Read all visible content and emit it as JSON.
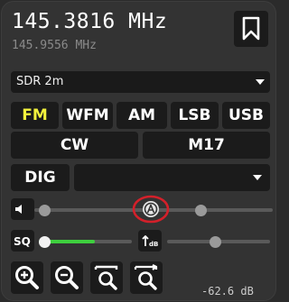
{
  "frequency": {
    "main": "145.3816 MHz",
    "secondary": "145.9556 MHz"
  },
  "profile_select": {
    "value": "SDR 2m"
  },
  "modes": {
    "row1": [
      {
        "label": "FM",
        "active": true
      },
      {
        "label": "WFM",
        "active": false
      },
      {
        "label": "AM",
        "active": false
      },
      {
        "label": "LSB",
        "active": false
      },
      {
        "label": "USB",
        "active": false
      }
    ],
    "row2": [
      {
        "label": "CW",
        "active": false
      },
      {
        "label": "M17",
        "active": false
      }
    ],
    "dig_label": "DIG",
    "dig_mode_value": ""
  },
  "sliders": {
    "volume": {
      "level": 0.0
    },
    "squelch": {
      "level": 0.0,
      "fill": 0.48
    },
    "squelch_right": {
      "level": 0.55
    }
  },
  "icons": {
    "bookmark": "bookmark-icon",
    "volume": "speaker-icon",
    "auto": "auto-squelch-icon",
    "sq": "squelch-label-icon",
    "agc": "agc-icon",
    "zoom_in": "zoom-in-icon",
    "zoom_out": "zoom-out-icon",
    "zoom_fit": "zoom-fit-icon",
    "zoom_reset": "zoom-reset-icon"
  },
  "colors": {
    "active_mode": "#f2f23c",
    "squelch_fill": "#3ecf3e",
    "highlight_ring": "#d3202a"
  },
  "meter": {
    "readout": "-62.6 dB"
  }
}
